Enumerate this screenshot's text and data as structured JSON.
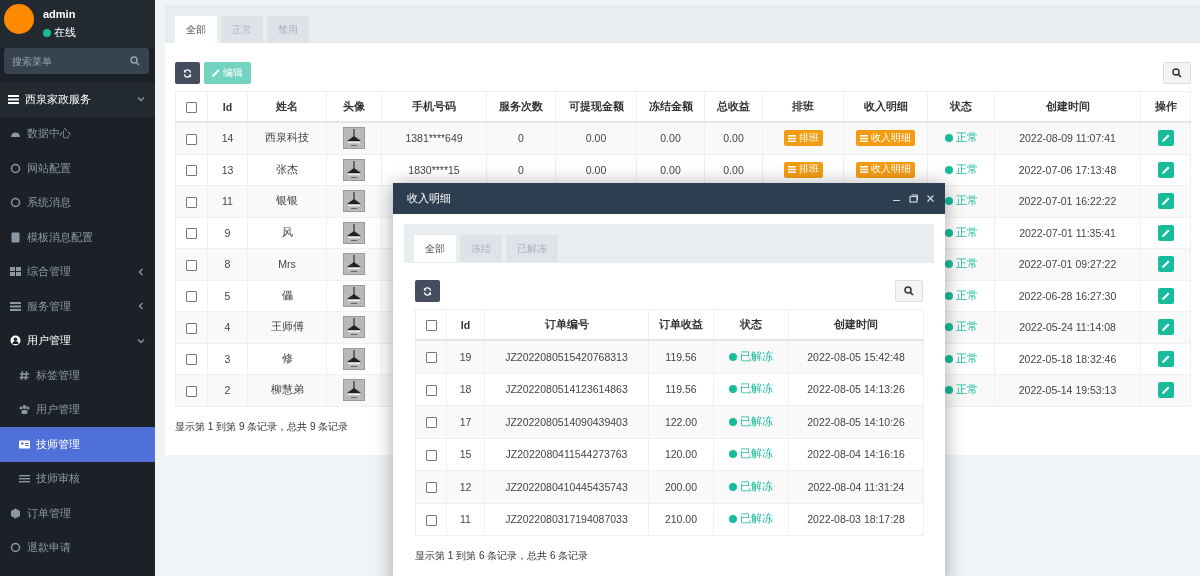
{
  "user": {
    "name": "admin",
    "status": "在线"
  },
  "sidebar": {
    "search": {
      "placeholder": "搜索菜单"
    },
    "items": [
      {
        "label": "西泉家政服务",
        "expanded": true,
        "selected": false,
        "children": [
          {
            "label": "数据中心",
            "selected": false
          },
          {
            "label": "网站配置",
            "selected": false
          },
          {
            "label": "系统消息",
            "selected": false
          },
          {
            "label": "模板消息配置",
            "selected": false
          },
          {
            "label": "综合管理",
            "expanded": false,
            "selected": false
          },
          {
            "label": "服务管理",
            "expanded": false,
            "selected": false
          },
          {
            "label": "用户管理",
            "expanded": true,
            "selected": false,
            "children": [
              {
                "label": "标签管理",
                "selected": false
              },
              {
                "label": "用户管理",
                "selected": false
              },
              {
                "label": "技师管理",
                "selected": true
              },
              {
                "label": "技师审核",
                "selected": false
              }
            ]
          },
          {
            "label": "订单管理",
            "selected": false
          },
          {
            "label": "退款申请",
            "selected": false
          }
        ]
      }
    ]
  },
  "tabs": [
    {
      "label": "全部",
      "selected": true
    },
    {
      "label": "正常",
      "selected": false
    },
    {
      "label": "禁用",
      "selected": false
    }
  ],
  "toolbar": {
    "edit_button": {
      "label": "编辑",
      "disabled": true
    }
  },
  "table": {
    "select_all": {
      "checked": false
    },
    "columns": [
      "Id",
      "姓名",
      "头像",
      "手机号码",
      "服务次数",
      "可提现金额",
      "冻结金额",
      "总收益",
      "排班",
      "收入明细",
      "状态",
      "创建时间",
      "操作"
    ],
    "rows": [
      {
        "checked": false,
        "id": "14",
        "name": "西泉科技",
        "phone": "1381****649",
        "service_count": "0",
        "withdrawable": "0.00",
        "frozen": "0.00",
        "total_income": "0.00",
        "schedule": "排班",
        "income": "收入明细",
        "status": "正常",
        "created": "2022-08-09 11:07:41"
      },
      {
        "checked": false,
        "id": "13",
        "name": "张杰",
        "phone": "1830****15",
        "service_count": "0",
        "withdrawable": "0.00",
        "frozen": "0.00",
        "total_income": "0.00",
        "schedule": "排班",
        "income": "收入明细",
        "status": "正常",
        "created": "2022-07-06 17:13:48"
      },
      {
        "checked": false,
        "id": "11",
        "name": "银银",
        "status": "正常",
        "created": "2022-07-01 16:22:22"
      },
      {
        "checked": false,
        "id": "9",
        "name": "风",
        "status": "正常",
        "created": "2022-07-01 11:35:41"
      },
      {
        "checked": false,
        "id": "8",
        "name": "Mrs",
        "status": "正常",
        "created": "2022-07-01 09:27:22"
      },
      {
        "checked": false,
        "id": "5",
        "name": "儡",
        "status": "正常",
        "created": "2022-06-28 16:27:30"
      },
      {
        "checked": false,
        "id": "4",
        "name": "王师傅",
        "status": "正常",
        "created": "2022-05-24 11:14:08"
      },
      {
        "checked": false,
        "id": "3",
        "name": "修",
        "status": "正常",
        "created": "2022-05-18 18:32:46"
      },
      {
        "checked": false,
        "id": "2",
        "name": "柳慧弟",
        "status": "正常",
        "created": "2022-05-14 19:53:13"
      }
    ],
    "footer": "显示第 1 到第 9 条记录，总共 9 条记录"
  },
  "dialog": {
    "title": "收入明细",
    "tabs": [
      {
        "label": "全部",
        "selected": true
      },
      {
        "label": "冻结",
        "selected": false
      },
      {
        "label": "已解冻",
        "selected": false
      }
    ],
    "table": {
      "select_all": {
        "checked": false
      },
      "columns": [
        "Id",
        "订单编号",
        "订单收益",
        "状态",
        "创建时间"
      ],
      "rows": [
        {
          "checked": false,
          "id": "19",
          "order_no": "JZ2022080515420768313",
          "income": "119.56",
          "status": "已解冻",
          "created": "2022-08-05 15:42:48"
        },
        {
          "checked": false,
          "id": "18",
          "order_no": "JZ2022080514123614863",
          "income": "119.56",
          "status": "已解冻",
          "created": "2022-08-05 14:13:26"
        },
        {
          "checked": false,
          "id": "17",
          "order_no": "JZ2022080514090439403",
          "income": "122.00",
          "status": "已解冻",
          "created": "2022-08-05 14:10:26"
        },
        {
          "checked": false,
          "id": "15",
          "order_no": "JZ2022080411544273763",
          "income": "120.00",
          "status": "已解冻",
          "created": "2022-08-04 14:16:16"
        },
        {
          "checked": false,
          "id": "12",
          "order_no": "JZ2022080410445435743",
          "income": "200.00",
          "status": "已解冻",
          "created": "2022-08-04 11:31:24"
        },
        {
          "checked": false,
          "id": "11",
          "order_no": "JZ2022080317194087033",
          "income": "210.00",
          "status": "已解冻",
          "created": "2022-08-03 18:17:28"
        }
      ],
      "footer": "显示第 1 到第 6 条记录，总共 6 条记录"
    }
  }
}
